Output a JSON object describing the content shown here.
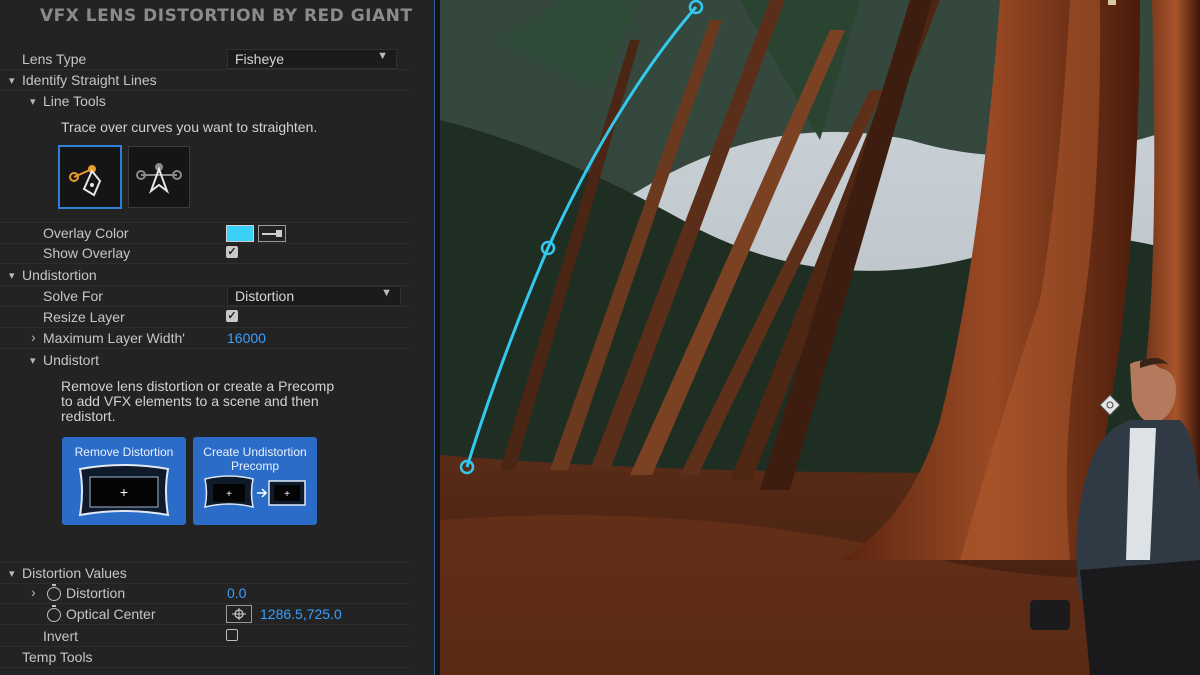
{
  "panel": {
    "title": "VFX LENS DISTORTION BY RED GIANT",
    "lens_type": {
      "label": "Lens Type",
      "value": "Fisheye"
    },
    "identify": {
      "label": "Identify Straight Lines",
      "line_tools_label": "Line Tools",
      "trace_text": "Trace over curves you want to straighten."
    },
    "overlay_color_label": "Overlay Color",
    "overlay_color_hex": "#3ad0f5",
    "show_overlay_label": "Show Overlay",
    "undistortion": {
      "label": "Undistortion",
      "solve_for_label": "Solve For",
      "solve_for_value": "Distortion",
      "resize_layer_label": "Resize Layer",
      "max_width_label": "Maximum Layer Width'",
      "max_width_value": "16000",
      "undistort_label": "Undistort",
      "undistort_desc_1": "Remove lens distortion or create a Precomp",
      "undistort_desc_2": "to add VFX elements to a scene and then",
      "undistort_desc_3": "redistort.",
      "remove_btn": "Remove Distortion",
      "create_btn_1": "Create Undistortion",
      "create_btn_2": "Precomp"
    },
    "distortion_values": {
      "label": "Distortion Values",
      "distortion_label": "Distortion",
      "distortion_value": "0.0",
      "optical_center_label": "Optical Center",
      "optical_center_value": "1286.5,725.0",
      "invert_label": "Invert"
    },
    "temp_tools_label": "Temp Tools"
  },
  "icons": {
    "twirl_open": "▾",
    "twirl_closed": "›",
    "check": "✓",
    "chevron": "⌄"
  }
}
